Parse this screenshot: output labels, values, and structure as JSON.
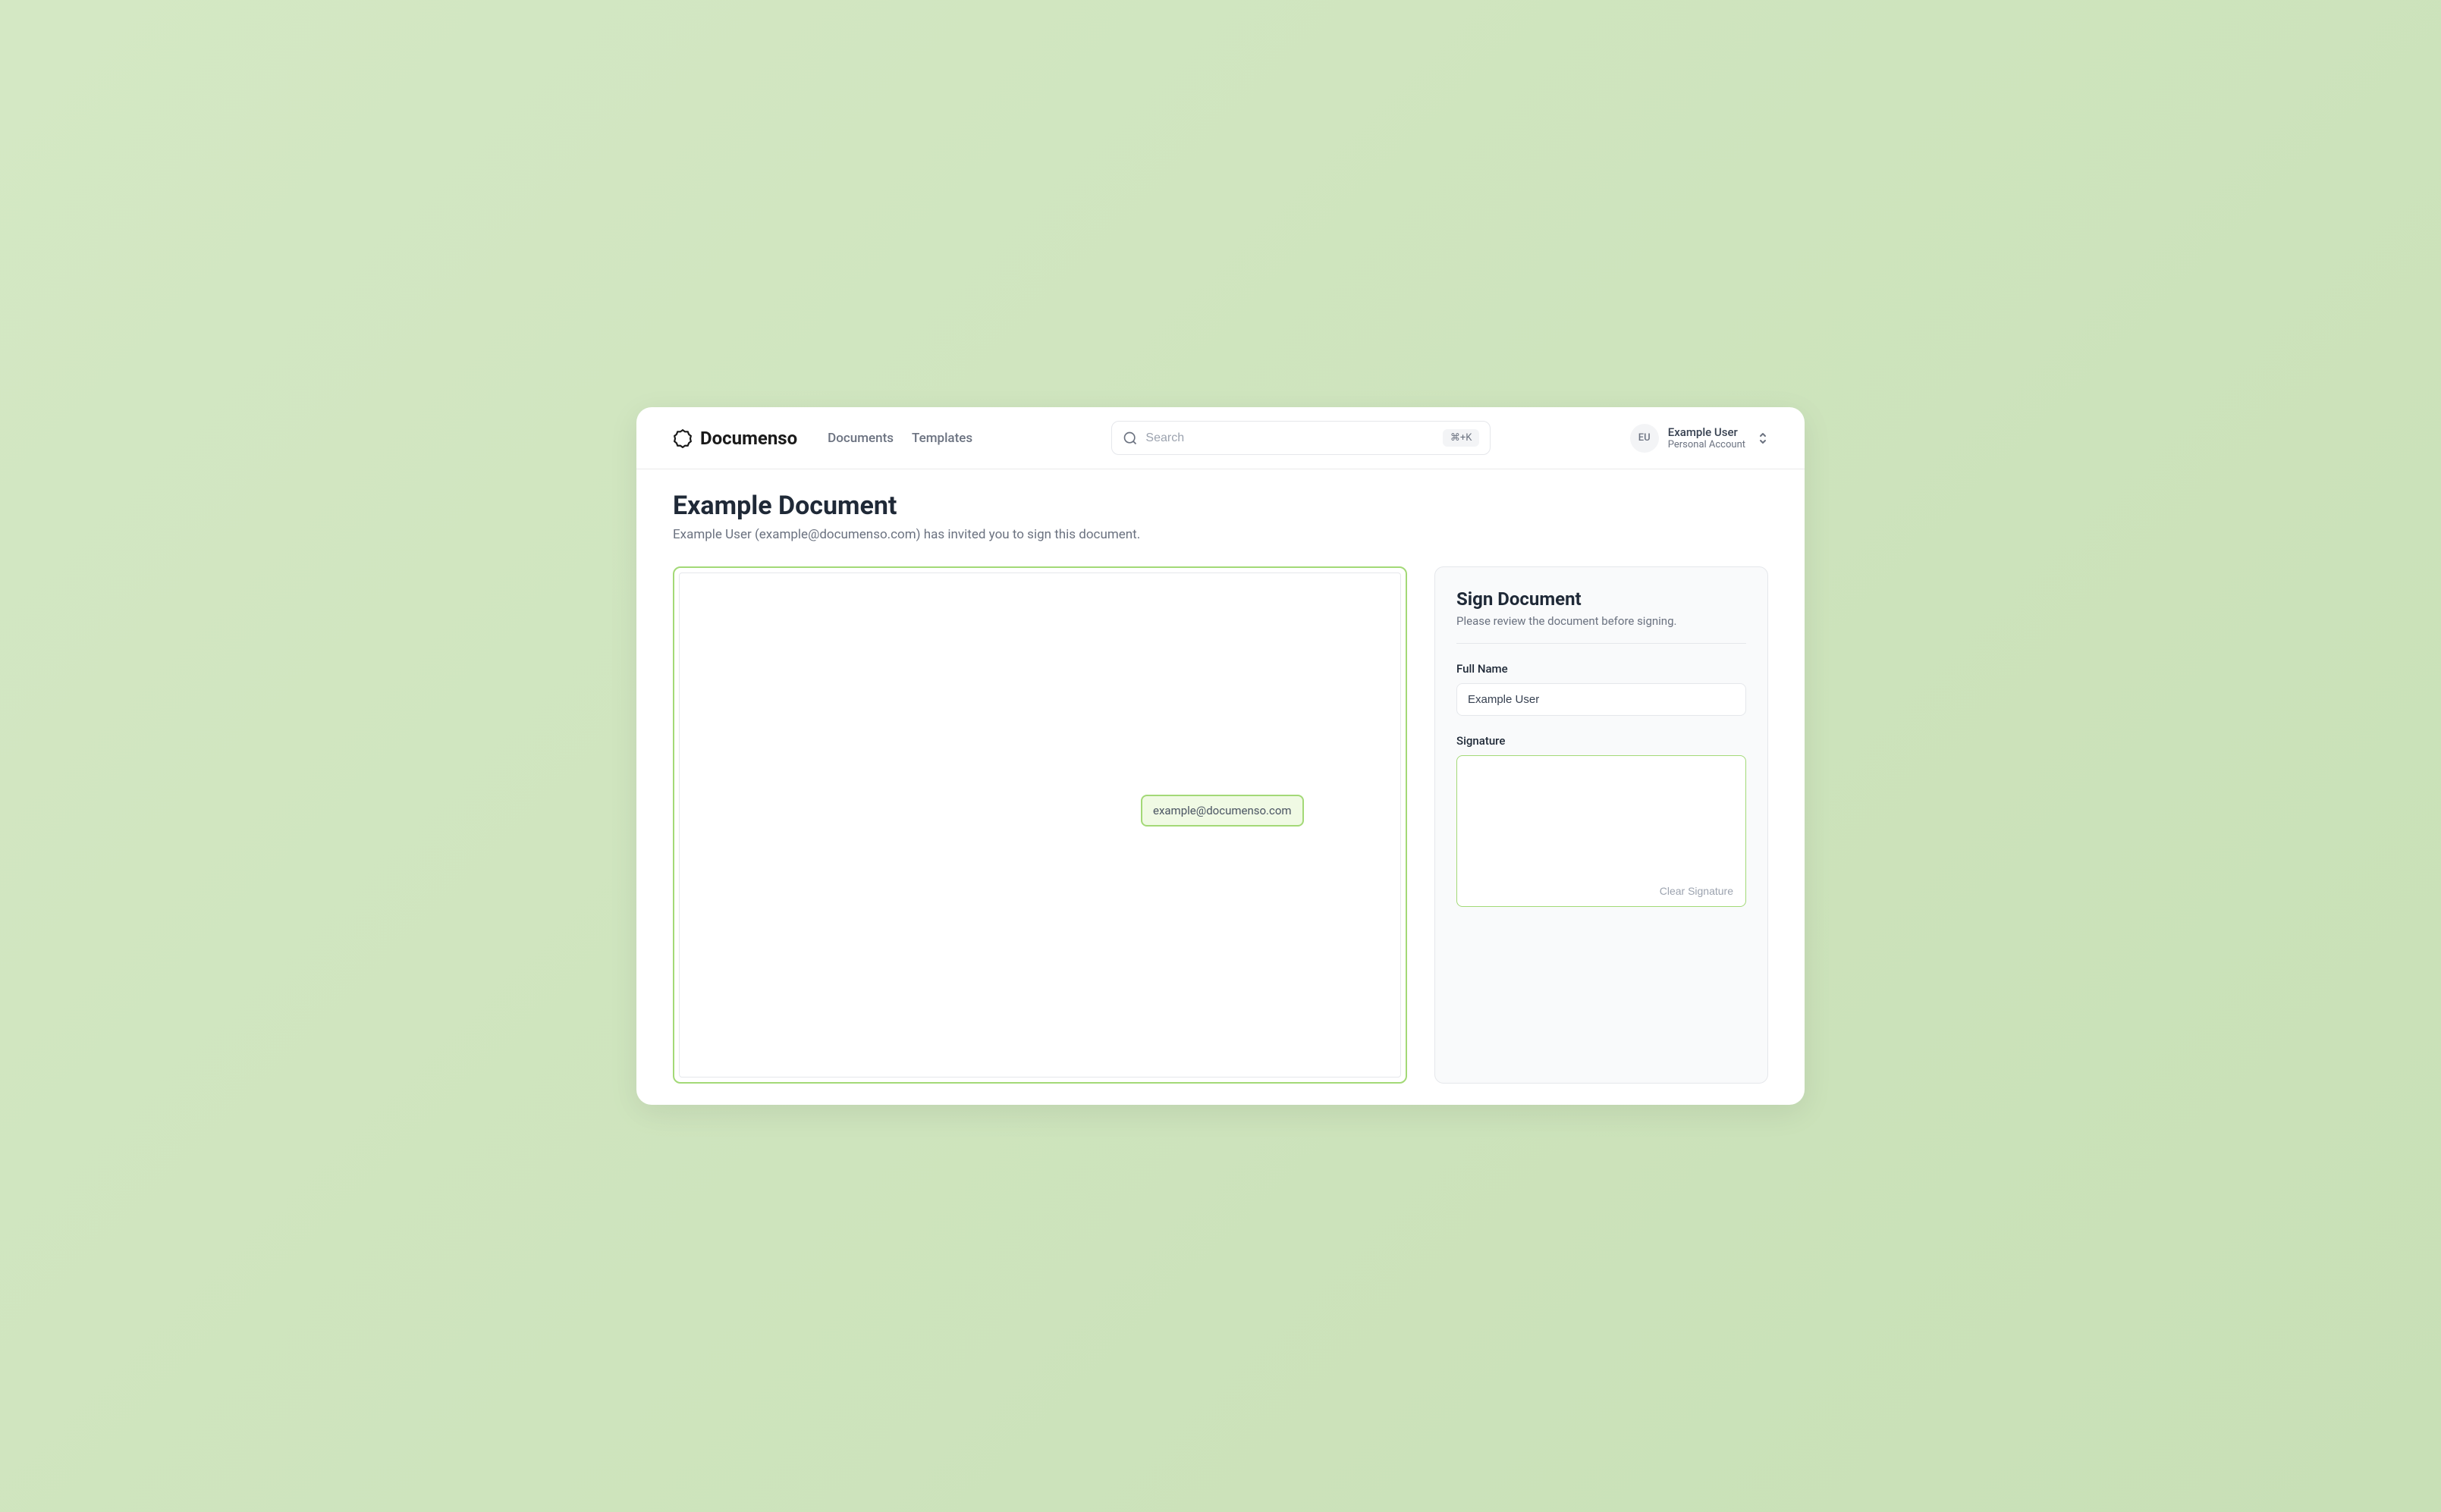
{
  "brand": {
    "name": "Documenso"
  },
  "nav": {
    "documents": "Documents",
    "templates": "Templates"
  },
  "search": {
    "placeholder": "Search",
    "shortcut": "⌘+K"
  },
  "user": {
    "initials": "EU",
    "name": "Example User",
    "subtitle": "Personal Account"
  },
  "page": {
    "title": "Example Document",
    "subtitle": "Example User (example@documenso.com) has invited you to sign this document."
  },
  "document": {
    "email_field_value": "example@documenso.com"
  },
  "sign_panel": {
    "title": "Sign Document",
    "subtitle": "Please review the document before signing.",
    "full_name_label": "Full Name",
    "full_name_value": "Example User",
    "signature_label": "Signature",
    "clear_signature_label": "Clear Signature"
  }
}
